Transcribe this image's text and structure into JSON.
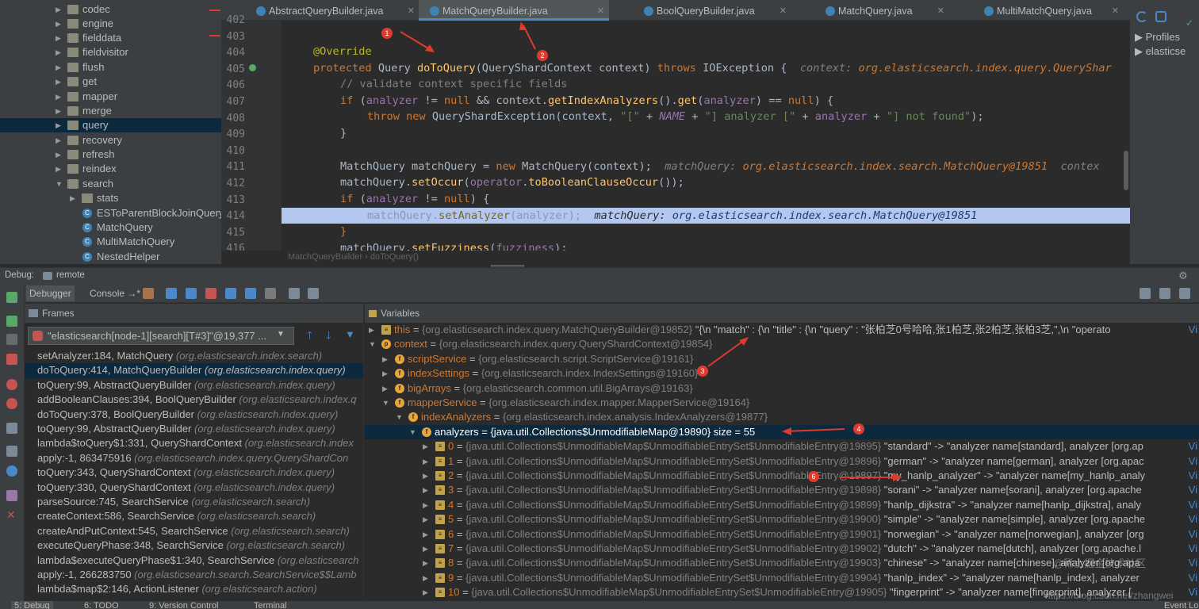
{
  "tree": {
    "items": [
      {
        "label": "codec",
        "expanded": false
      },
      {
        "label": "engine",
        "expanded": false
      },
      {
        "label": "fielddata",
        "expanded": false
      },
      {
        "label": "fieldvisitor",
        "expanded": false
      },
      {
        "label": "flush",
        "expanded": false
      },
      {
        "label": "get",
        "expanded": false
      },
      {
        "label": "mapper",
        "expanded": false
      },
      {
        "label": "merge",
        "expanded": false
      },
      {
        "label": "query",
        "expanded": false,
        "selected": true
      },
      {
        "label": "recovery",
        "expanded": false
      },
      {
        "label": "refresh",
        "expanded": false
      },
      {
        "label": "reindex",
        "expanded": false
      },
      {
        "label": "search",
        "expanded": true
      },
      {
        "label": "stats",
        "expanded": false,
        "child": true
      },
      {
        "label": "ESToParentBlockJoinQuery",
        "class": true
      },
      {
        "label": "MatchQuery",
        "class": true
      },
      {
        "label": "MultiMatchQuery",
        "class": true
      },
      {
        "label": "NestedHelper",
        "class": true
      }
    ]
  },
  "editor": {
    "tabs": [
      {
        "label": "AbstractQueryBuilder.java",
        "active": false
      },
      {
        "label": "MatchQueryBuilder.java",
        "active": true
      },
      {
        "label": "BoolQueryBuilder.java",
        "active": false
      },
      {
        "label": "MatchQuery.java",
        "active": false
      },
      {
        "label": "MultiMatchQuery.java",
        "active": false
      }
    ],
    "line_numbers": [
      "402",
      "403",
      "404",
      "405",
      "406",
      "407",
      "408",
      "409",
      "410",
      "411",
      "412",
      "413",
      "414",
      "415",
      "416"
    ],
    "breadcrumb": "MatchQueryBuilder  ›  doToQuery()",
    "code": {
      "l404": "@Override",
      "l405_kw": "protected ",
      "l405_type": "Query ",
      "l405_fn": "doToQuery",
      "l405_rest": "(QueryShardContext context) ",
      "l405_throws": "throws ",
      "l405_ex": "IOException {  ",
      "l405_dbg_lbl": "context: ",
      "l405_dbg_val": "org.elasticsearch.index.query.QueryShar",
      "l406": "// validate context specific fields",
      "l407_kw": "if ",
      "l407_a": "(",
      "l407_f1": "analyzer",
      "l407_b": " != ",
      "l407_null1": "null",
      "l407_c": " && context.",
      "l407_m1": "getIndexAnalyzers",
      "l407_d": "().",
      "l407_m2": "get",
      "l407_e": "(",
      "l407_f2": "analyzer",
      "l407_g": ") == ",
      "l407_null2": "null",
      "l407_h": ") {",
      "l408_kw1": "throw ",
      "l408_kw2": "new ",
      "l408_a": "QueryShardException(context, ",
      "l408_s1": "\"[\"",
      "l408_b": " + ",
      "l408_name": "NAME",
      "l408_c": " + ",
      "l408_s2": "\"] analyzer [\"",
      "l408_d": " + ",
      "l408_f": "analyzer",
      "l408_e": " + ",
      "l408_s3": "\"] not found\"",
      "l408_f2": ");",
      "l409": "}",
      "l411_a": "MatchQuery matchQuery = ",
      "l411_kw": "new ",
      "l411_b": "MatchQuery(context);  ",
      "l411_dbg_lbl": "matchQuery: ",
      "l411_dbg_val": "org.elasticsearch.index.search.MatchQuery@19851  ",
      "l411_dbg_more": "contex",
      "l412_a": "matchQuery.",
      "l412_m": "setOccur",
      "l412_b": "(",
      "l412_f": "operator",
      "l412_c": ".",
      "l412_m2": "toBooleanClauseOccur",
      "l412_d": "());",
      "l413_kw": "if ",
      "l413_a": "(",
      "l413_f": "analyzer",
      "l413_b": " != ",
      "l413_null": "null",
      "l413_c": ") {",
      "l414_a": "matchQuery.",
      "l414_m": "setAnalyzer",
      "l414_b": "(",
      "l414_f": "analyzer",
      "l414_c": ");  ",
      "l414_dbg_lbl": "matchQuery: ",
      "l414_dbg_val": "org.elasticsearch.index.search.MatchQuery@19851",
      "l415": "}",
      "l416_a": "matchQuery.",
      "l416_m": "setFuzziness",
      "l416_b": "(",
      "l416_f": "fuzziness",
      "l416_c": ");"
    }
  },
  "right_panel": {
    "items": [
      "Profiles",
      "elasticse"
    ]
  },
  "tooltip": "null",
  "debug": {
    "label": "Debug:",
    "config": "remote",
    "tabs": [
      {
        "label": "Debugger",
        "active": true
      },
      {
        "label": "Console →*",
        "active": false
      }
    ],
    "frames_title": "Frames",
    "variables_title": "Variables",
    "thread": "\"elasticsearch[node-1][search][T#3]\"@19,377 ...",
    "frames": [
      {
        "method": "setAnalyzer:184, MatchQuery",
        "pkg": "(org.elasticsearch.index.search)"
      },
      {
        "method": "doToQuery:414, MatchQueryBuilder",
        "pkg": "(org.elasticsearch.index.query)",
        "selected": true
      },
      {
        "method": "toQuery:99, AbstractQueryBuilder",
        "pkg": "(org.elasticsearch.index.query)"
      },
      {
        "method": "addBooleanClauses:394, BoolQueryBuilder",
        "pkg": "(org.elasticsearch.index.q"
      },
      {
        "method": "doToQuery:378, BoolQueryBuilder",
        "pkg": "(org.elasticsearch.index.query)"
      },
      {
        "method": "toQuery:99, AbstractQueryBuilder",
        "pkg": "(org.elasticsearch.index.query)"
      },
      {
        "method": "lambda$toQuery$1:331, QueryShardContext",
        "pkg": "(org.elasticsearch.index"
      },
      {
        "method": "apply:-1, 863475916",
        "pkg": "(org.elasticsearch.index.query.QueryShardCon"
      },
      {
        "method": "toQuery:343, QueryShardContext",
        "pkg": "(org.elasticsearch.index.query)"
      },
      {
        "method": "toQuery:330, QueryShardContext",
        "pkg": "(org.elasticsearch.index.query)"
      },
      {
        "method": "parseSource:745, SearchService",
        "pkg": "(org.elasticsearch.search)"
      },
      {
        "method": "createContext:586, SearchService",
        "pkg": "(org.elasticsearch.search)"
      },
      {
        "method": "createAndPutContext:545, SearchService",
        "pkg": "(org.elasticsearch.search)"
      },
      {
        "method": "executeQueryPhase:348, SearchService",
        "pkg": "(org.elasticsearch.search)"
      },
      {
        "method": "lambda$executeQueryPhase$1:340, SearchService",
        "pkg": "(org.elasticsearch"
      },
      {
        "method": "apply:-1, 266283750",
        "pkg": "(org.elasticsearch.search.SearchService$$Lamb"
      },
      {
        "method": "lambda$map$2:146, ActionListener",
        "pkg": "(org.elasticsearch.action)"
      }
    ],
    "variables": [
      {
        "name": "this",
        "eq": " = ",
        "type": "{org.elasticsearch.index.query.MatchQueryBuilder@19852}",
        "val": " \"{\\n  \"match\" : {\\n    \"title\" : {\\n      \"query\" : \"张柏芝0号哈哈,张1柏芝,张2柏芝,张柏3芝,\",\\n      \"operato",
        "icon": "list",
        "expand": "collapsed",
        "lvl": 0
      },
      {
        "name": "context",
        "eq": " = ",
        "type": "{org.elasticsearch.index.query.QueryShardContext@19854}",
        "val": "",
        "icon": "p",
        "expand": "expanded",
        "lvl": 0
      },
      {
        "name": "scriptService",
        "eq": " = ",
        "type": "{org.elasticsearch.script.ScriptService@19161}",
        "val": "",
        "icon": "f",
        "expand": "collapsed",
        "lvl": 1
      },
      {
        "name": "indexSettings",
        "eq": " = ",
        "type": "{org.elasticsearch.index.IndexSettings@19160}",
        "val": "",
        "icon": "f",
        "expand": "collapsed",
        "lvl": 1
      },
      {
        "name": "bigArrays",
        "eq": " = ",
        "type": "{org.elasticsearch.common.util.BigArrays@19163}",
        "val": "",
        "icon": "f",
        "expand": "collapsed",
        "lvl": 1
      },
      {
        "name": "mapperService",
        "eq": " = ",
        "type": "{org.elasticsearch.index.mapper.MapperService@19164}",
        "val": "",
        "icon": "f",
        "expand": "expanded",
        "lvl": 1
      },
      {
        "name": "indexAnalyzers",
        "eq": " = ",
        "type": "{org.elasticsearch.index.analysis.IndexAnalyzers@19877}",
        "val": "",
        "icon": "f",
        "expand": "expanded",
        "lvl": 2
      },
      {
        "name": "analyzers",
        "eq": " = ",
        "type": "{java.util.Collections$UnmodifiableMap@19890}",
        "val": "  size = 55",
        "icon": "f",
        "expand": "expanded",
        "lvl": 3,
        "selected": true
      },
      {
        "name": "0",
        "eq": " = ",
        "type": "{java.util.Collections$UnmodifiableMap$UnmodifiableEntrySet$UnmodifiableEntry@19895}",
        "val": " \"standard\" -> \"analyzer name[standard], analyzer [org.ap",
        "icon": "list",
        "expand": "collapsed",
        "lvl": 4
      },
      {
        "name": "1",
        "eq": " = ",
        "type": "{java.util.Collections$UnmodifiableMap$UnmodifiableEntrySet$UnmodifiableEntry@19896}",
        "val": " \"german\" -> \"analyzer name[german], analyzer [org.apac",
        "icon": "list",
        "expand": "collapsed",
        "lvl": 4
      },
      {
        "name": "2",
        "eq": " = ",
        "type": "{java.util.Collections$UnmodifiableMap$UnmodifiableEntrySet$UnmodifiableEntry@19897}",
        "val": " \"my_hanlp_analyzer\" -> \"analyzer name[my_hanlp_analy",
        "icon": "list",
        "expand": "collapsed",
        "lvl": 4
      },
      {
        "name": "3",
        "eq": " = ",
        "type": "{java.util.Collections$UnmodifiableMap$UnmodifiableEntrySet$UnmodifiableEntry@19898}",
        "val": " \"sorani\" -> \"analyzer name[sorani], analyzer [org.apache",
        "icon": "list",
        "expand": "collapsed",
        "lvl": 4
      },
      {
        "name": "4",
        "eq": " = ",
        "type": "{java.util.Collections$UnmodifiableMap$UnmodifiableEntrySet$UnmodifiableEntry@19899}",
        "val": " \"hanlp_dijkstra\" -> \"analyzer name[hanlp_dijkstra], analy",
        "icon": "list",
        "expand": "collapsed",
        "lvl": 4
      },
      {
        "name": "5",
        "eq": " = ",
        "type": "{java.util.Collections$UnmodifiableMap$UnmodifiableEntrySet$UnmodifiableEntry@19900}",
        "val": " \"simple\" -> \"analyzer name[simple], analyzer [org.apache",
        "icon": "list",
        "expand": "collapsed",
        "lvl": 4
      },
      {
        "name": "6",
        "eq": " = ",
        "type": "{java.util.Collections$UnmodifiableMap$UnmodifiableEntrySet$UnmodifiableEntry@19901}",
        "val": " \"norwegian\" -> \"analyzer name[norwegian], analyzer [org",
        "icon": "list",
        "expand": "collapsed",
        "lvl": 4
      },
      {
        "name": "7",
        "eq": " = ",
        "type": "{java.util.Collections$UnmodifiableMap$UnmodifiableEntrySet$UnmodifiableEntry@19902}",
        "val": " \"dutch\" -> \"analyzer name[dutch], analyzer [org.apache.l",
        "icon": "list",
        "expand": "collapsed",
        "lvl": 4
      },
      {
        "name": "8",
        "eq": " = ",
        "type": "{java.util.Collections$UnmodifiableMap$UnmodifiableEntrySet$UnmodifiableEntry@19903}",
        "val": " \"chinese\" -> \"analyzer name[chinese], analyzer [org.apa",
        "icon": "list",
        "expand": "collapsed",
        "lvl": 4
      },
      {
        "name": "9",
        "eq": " = ",
        "type": "{java.util.Collections$UnmodifiableMap$UnmodifiableEntrySet$UnmodifiableEntry@19904}",
        "val": " \"hanlp_index\" -> \"analyzer name[hanlp_index], analyzer",
        "icon": "list",
        "expand": "collapsed",
        "lvl": 4
      },
      {
        "name": "10",
        "eq": " = ",
        "type": "{java.util.Collections$UnmodifiableMap$UnmodifiableEntrySet$UnmodifiableEntry@19905}",
        "val": " \"fingerprint\" -> \"analyzer name[fingerprint], analyzer [",
        "icon": "list",
        "expand": "collapsed",
        "lvl": 4
      }
    ],
    "view_link": "Vi"
  },
  "annotations": [
    "1",
    "2",
    "3",
    "4",
    "6"
  ],
  "watermark": "@稀土掘金技术社区",
  "watermark2": "https://blog.csdn.net/zhangwei",
  "status": {
    "items": [
      "5: Debug",
      "6: TODO",
      "9: Version Control",
      "Terminal",
      "Event Lo"
    ]
  },
  "colors": {
    "accent": "#4a88c7",
    "selection": "#0d293e",
    "exec_line": "#b3c7f0",
    "annotation": "#e03a2f"
  }
}
